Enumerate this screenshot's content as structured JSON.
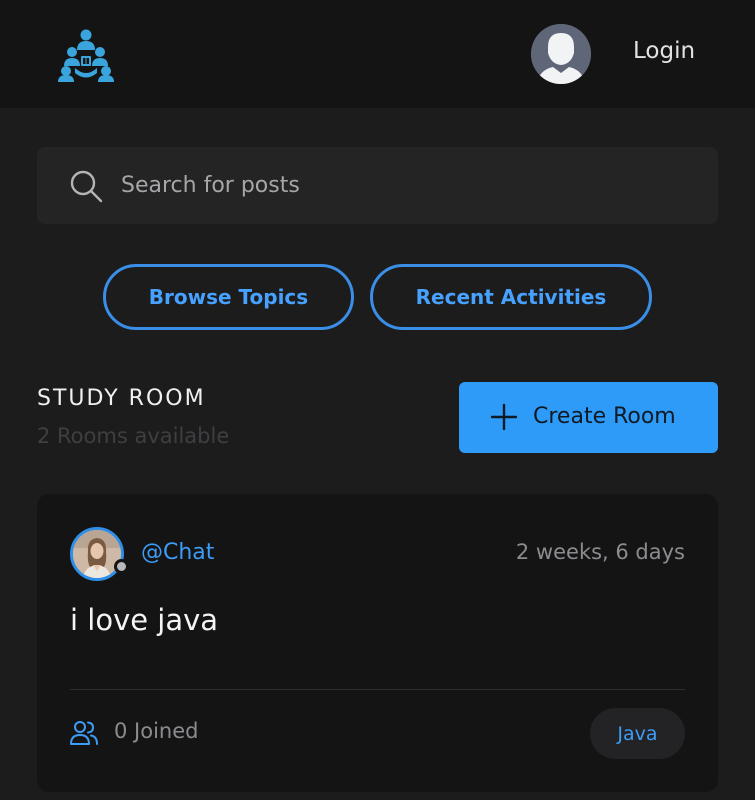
{
  "header": {
    "logo_icon": "study-group-logo-icon",
    "avatar_icon": "user-avatar-icon",
    "login_label": "Login"
  },
  "search": {
    "placeholder": "Search for posts",
    "value": "",
    "icon": "search-icon"
  },
  "nav": {
    "browse_label": "Browse Topics",
    "recent_label": "Recent Activities"
  },
  "section": {
    "title": "STUDY ROOM",
    "subtitle": "2 Rooms available",
    "create_label": "Create Room",
    "create_icon": "plus-icon"
  },
  "rooms": [
    {
      "host": "@Chat",
      "time": "2 weeks, 6 days",
      "title": "i love java",
      "joined": "0 Joined",
      "topic": "Java",
      "status": "offline"
    }
  ],
  "colors": {
    "accent": "#2f9bf8",
    "link": "#3d9cf5",
    "background": "#1c1c1d",
    "header": "#141415",
    "card": "#141415"
  }
}
